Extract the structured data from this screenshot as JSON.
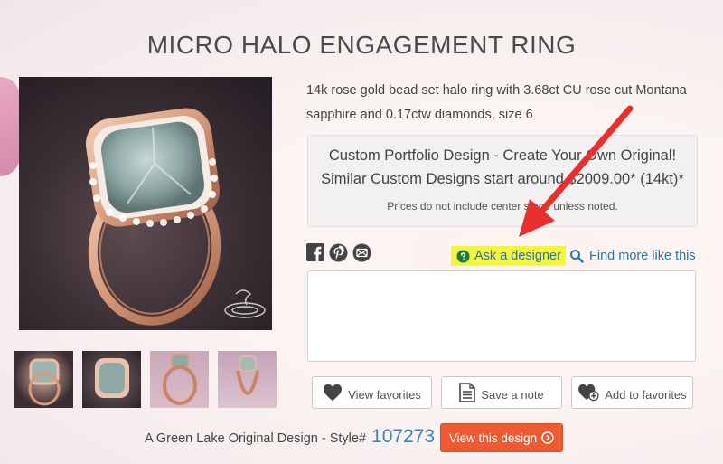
{
  "page": {
    "title": "MICRO HALO ENGAGEMENT RING",
    "description": "14k rose gold bead set halo ring with 3.68ct CU rose cut Montana sapphire and 0.17ctw diamonds, size 6"
  },
  "portfolio": {
    "line1": "Custom Portfolio Design - Create Your Own Original!",
    "line2_prefix": "Similar Custom Designs start around $2009.00* (14kt)*",
    "note": "Prices do not include center stone unless noted."
  },
  "actions": {
    "ask_designer": "Ask a designer",
    "find_more": "Find more like this",
    "message_placeholder": ""
  },
  "buttons": {
    "view_favorites": "View favorites",
    "save_note": "Save a note",
    "add_favorites": "Add to favorites",
    "view_design": "View this design"
  },
  "footer": {
    "label": "A Green Lake Original Design - Style#",
    "style_number": "107273"
  },
  "icons": {
    "facebook": "facebook-icon",
    "pinterest": "pinterest-icon",
    "email": "email-icon",
    "question": "question-circle-icon",
    "search": "search-icon",
    "heart": "heart-icon",
    "note": "note-icon",
    "heart_plus": "heart-plus-icon",
    "chevron": "chevron-right-circle-icon"
  },
  "colors": {
    "accent_blue": "#2b73a8",
    "highlight": "#f2f542",
    "cta": "#ee5b32",
    "arrow": "#e8302e"
  }
}
